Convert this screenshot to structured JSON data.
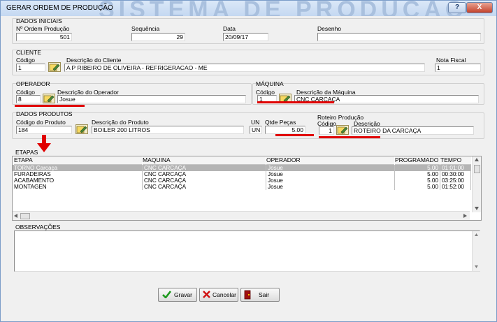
{
  "window": {
    "title": "GERAR ORDEM DE PRODUÇÃO",
    "watermark": "SISTEMA DE PRODUÇÃO",
    "help_label": "?",
    "close_label": "X"
  },
  "dados_iniciais": {
    "heading": "DADOS INICIAIS",
    "ordem_label": "Nº Ordem Produção",
    "ordem_value": "501",
    "sequencia_label": "Sequência",
    "sequencia_value": "29",
    "data_label": "Data",
    "data_value": "20/09/17",
    "desenho_label": "Desenho",
    "desenho_value": ""
  },
  "cliente": {
    "heading": "CLIENTE",
    "codigo_label": "Código",
    "codigo_value": "1",
    "descricao_label": "Descrição do Cliente",
    "descricao_value": "A P RIBEIRO DE OLIVEIRA - REFRIGERACAO - ME",
    "nota_label": "Nota Fiscal",
    "nota_value": "1"
  },
  "operador": {
    "heading": "OPERADOR",
    "codigo_label": "Código",
    "codigo_value": "8",
    "descricao_label": "Descrição do Operador",
    "descricao_value": "Josue"
  },
  "maquina": {
    "heading": "MÁQUINA",
    "codigo_label": "Código",
    "codigo_value": "1",
    "descricao_label": "Descrição da Máquina",
    "descricao_value": "CNC CARCAÇA"
  },
  "produtos": {
    "heading": "DADOS PRODUTOS",
    "codigo_label": "Código do Produto",
    "codigo_value": "184",
    "descricao_label": "Descrição do Produto",
    "descricao_value": "BOILER 200 LITROS",
    "un_label": "UN",
    "un_value": "UN",
    "qtde_label": "Qtde Peças",
    "qtde_value": "5.00",
    "roteiro_label": "Roteiro Produção",
    "roteiro_codigo_label": "Código",
    "roteiro_codigo_value": "1",
    "roteiro_descricao_label": "Descrição",
    "roteiro_descricao_value": "ROTEIRO DA CARCAÇA"
  },
  "etapas": {
    "heading": "ETAPAS",
    "columns": [
      "ETAPA",
      "MAQUINA",
      "OPERADOR",
      "PROGRAMADO",
      "TEMPO"
    ],
    "rows": [
      [
        "TORNO Carcaça",
        "CNC CARCAÇA",
        "Josue",
        "5.00",
        "01:01:00"
      ],
      [
        "FURADEIRAS",
        "CNC CARCAÇA",
        "Josue",
        "5.00",
        "00:30:00"
      ],
      [
        "ACABAMENTO",
        "CNC CARCAÇA",
        "Josue",
        "5.00",
        "03:25:00"
      ],
      [
        "MONTAGEN",
        "CNC CARCAÇA",
        "Josue",
        "5.00",
        "01:52:00"
      ]
    ]
  },
  "observacoes": {
    "heading": "OBSERVAÇÕES",
    "value": ""
  },
  "buttons": {
    "gravar": "Gravar",
    "cancelar": "Cancelar",
    "sair": "Sair"
  },
  "colors": {
    "highlight_red": "#e00000",
    "selected_row": "#b4b4b4",
    "gravar_icon": "#1e9a1e",
    "cancelar_icon": "#d01010",
    "sair_icon": "#a01010"
  },
  "icons": {
    "pick_buttons": "pencil-folder-icon",
    "scroll": "scroll-arrow-icon",
    "annotation": "red-down-arrow-icon"
  }
}
